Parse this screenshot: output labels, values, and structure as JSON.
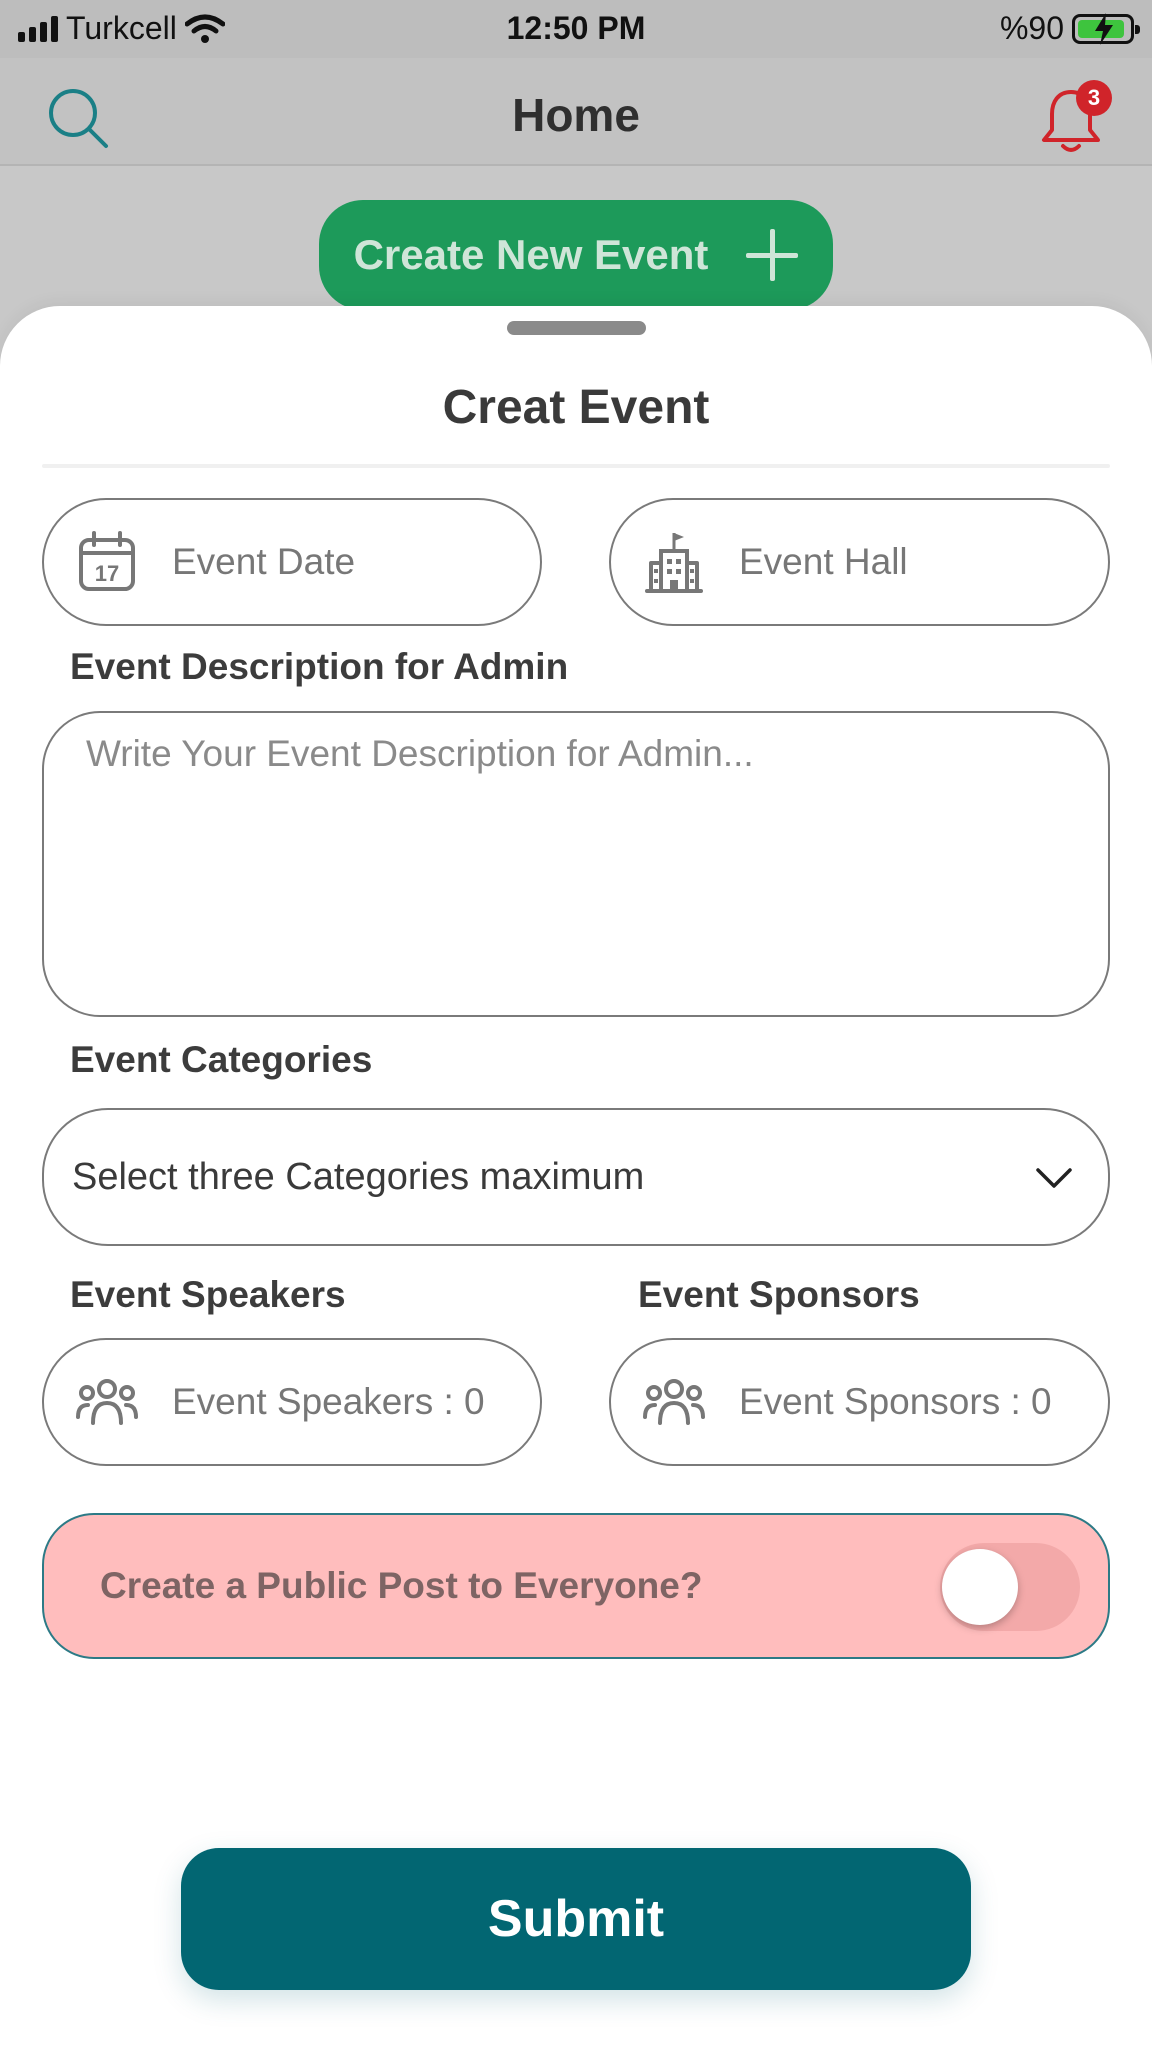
{
  "status_bar": {
    "carrier": "Turkcell",
    "time": "12:50 PM",
    "battery": "%90"
  },
  "nav": {
    "title": "Home",
    "notification_count": "3"
  },
  "background": {
    "create_button_label": "Create New Event"
  },
  "sheet": {
    "title": "Creat Event",
    "event_date_placeholder": "Event Date",
    "event_hall_placeholder": "Event Hall",
    "description_label": "Event Description for Admin",
    "description_placeholder": "Write Your Event Description for Admin...",
    "categories_label": "Event Categories",
    "categories_placeholder": "Select three Categories maximum",
    "speakers_label": "Event Speakers",
    "sponsors_label": "Event Sponsors",
    "speakers_value": "Event Speakers : 0",
    "sponsors_value": "Event Sponsors : 0",
    "public_post_label": "Create a Public Post to Everyone?",
    "public_post_enabled": false,
    "submit_label": "Submit"
  },
  "colors": {
    "primary": "#026672",
    "create_button": "#1d9a5a",
    "toggle_card_bg": "#ffbdbd",
    "badge": "#d0242a",
    "bell": "#d0242a",
    "search_icon": "#1a7f86"
  }
}
